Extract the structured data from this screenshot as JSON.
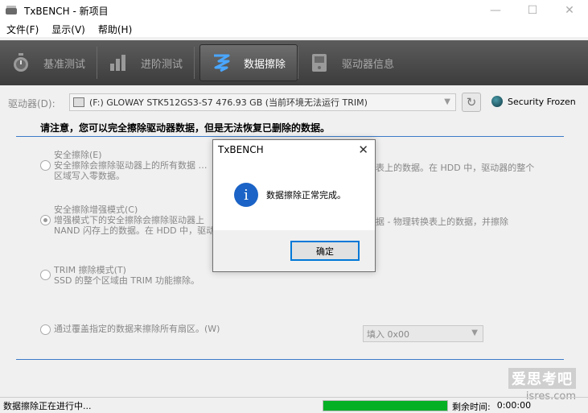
{
  "window": {
    "title": "TxBENCH - 新项目",
    "minimize": "—",
    "maximize": "☐",
    "close": "✕"
  },
  "menu": [
    "文件(F)",
    "显示(V)",
    "帮助(H)"
  ],
  "toolbar": {
    "benchmark": "基准测试",
    "advanced": "进阶测试",
    "erase": "数据擦除",
    "drive_info": "驱动器信息"
  },
  "drive": {
    "label": "驱动器(D):",
    "selected": "(F:) GLOWAY STK512GS3-S7  476.93 GB (当前环境无法运行 TRIM)",
    "security": "Security Frozen"
  },
  "notice": "请注意，您可以完全擦除驱动器数据，但是无法恢复已删除的数据。",
  "options": [
    {
      "title": "安全擦除(E)",
      "line1": "安全擦除会擦除驱动器上的所有数据 …",
      "line1b": "表上的数据。在 HDD 中，驱动器的整个",
      "line2": "区域写入零数据。"
    },
    {
      "title": "安全擦除增强模式(C)",
      "line1": "增强模式下的安全擦除会擦除驱动器上",
      "line1b": "据 - 物理转换表上的数据，并擦除",
      "line2": "NAND 闪存上的数据。在 HDD 中，驱动"
    },
    {
      "title": "TRIM 擦除模式(T)",
      "line1": "SSD 的整个区域由 TRIM 功能擦除。"
    },
    {
      "title": "通过覆盖指定的数据来擦除所有扇区。(W)"
    }
  ],
  "fill_select": "填入 0x00",
  "watermark": {
    "text1": "爱思考吧",
    "text2": "isres.com"
  },
  "status": {
    "text": "数据擦除正在进行中...",
    "progress": 1.0,
    "remain_label": "剩余时间:",
    "remain_value": "0:00:00"
  },
  "dialog": {
    "title": "TxBENCH",
    "message": "数据擦除正常完成。",
    "ok": "确定",
    "icon_glyph": "i"
  },
  "colors": {
    "accent": "#0078d7",
    "progress": "#06b025",
    "info": "#1b63c6",
    "toolbar": "#4a4a4a"
  }
}
